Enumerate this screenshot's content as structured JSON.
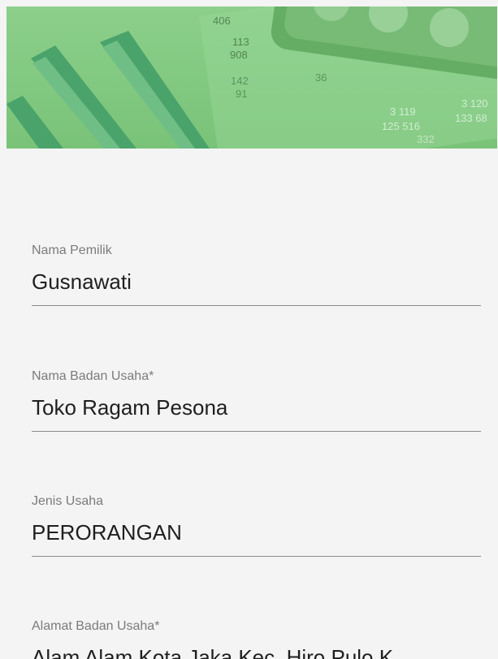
{
  "header": {
    "image_numbers": [
      "406",
      "113",
      "908",
      "142",
      "91",
      "36",
      "3 119",
      "125 516",
      "332",
      "3 120",
      "133 68"
    ]
  },
  "form": {
    "fields": [
      {
        "label": "Nama Pemilik",
        "value": "Gusnawati"
      },
      {
        "label": "Nama Badan Usaha*",
        "value": "Toko Ragam Pesona"
      },
      {
        "label": "Jenis Usaha",
        "value": "PERORANGAN"
      },
      {
        "label": "Alamat Badan Usaha*",
        "value": "Alam Alam Kota Jaka Kec. Hiro Pulo K"
      }
    ]
  },
  "colors": {
    "banner_green": "#85c984",
    "background": "#f4f4f4",
    "label_gray": "#7b7b7b",
    "value_text": "#1f1f1f",
    "underline": "#8a8a8a"
  }
}
